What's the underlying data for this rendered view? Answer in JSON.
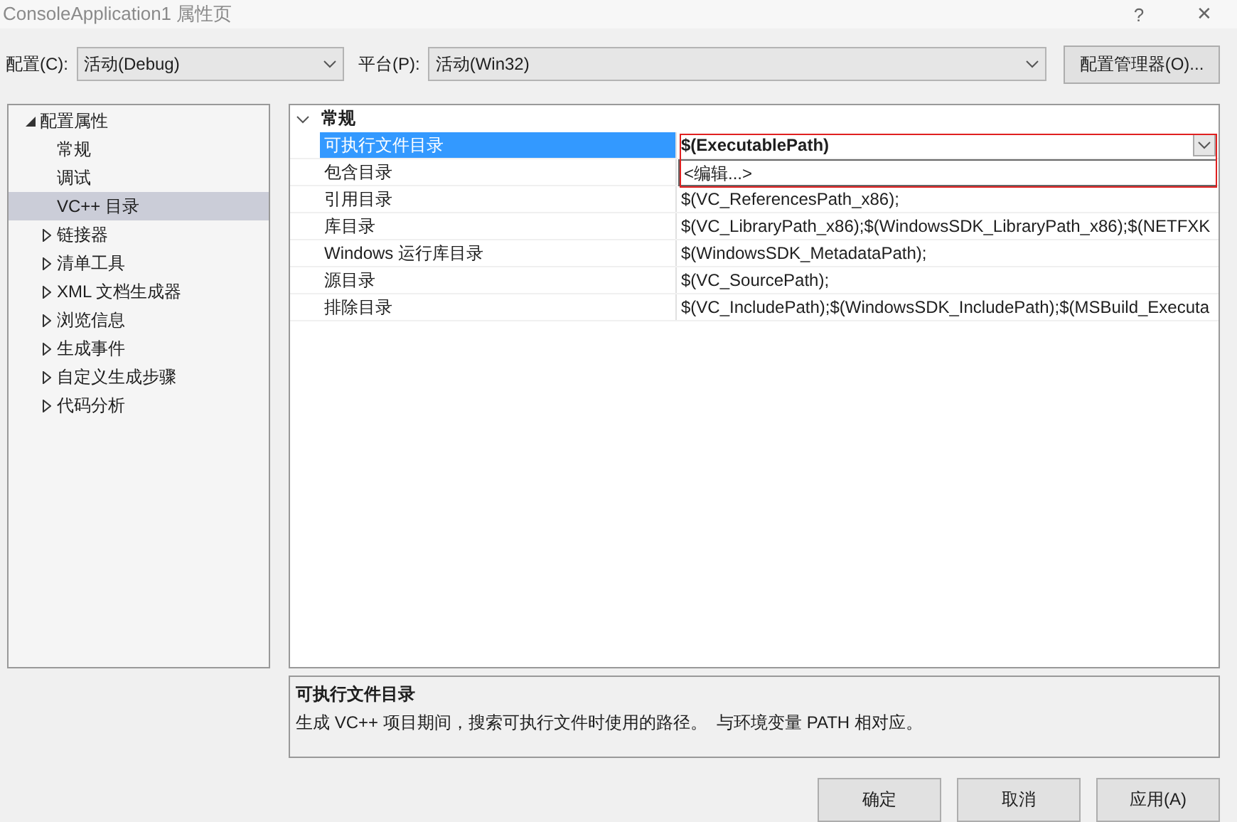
{
  "window": {
    "title": "ConsoleApplication1 属性页",
    "help": "?",
    "close": "✕"
  },
  "toolbar": {
    "config_label": "配置(C):",
    "config_value": "活动(Debug)",
    "platform_label": "平台(P):",
    "platform_value": "活动(Win32)",
    "manager_button": "配置管理器(O)..."
  },
  "tree": [
    {
      "label": "配置属性",
      "expanded": true,
      "selected": false,
      "children": [
        {
          "label": "常规",
          "selected": false,
          "expandable": false
        },
        {
          "label": "调试",
          "selected": false,
          "expandable": false
        },
        {
          "label": "VC++ 目录",
          "selected": true,
          "expandable": false
        },
        {
          "label": "链接器",
          "selected": false,
          "expandable": true
        },
        {
          "label": "清单工具",
          "selected": false,
          "expandable": true
        },
        {
          "label": "XML 文档生成器",
          "selected": false,
          "expandable": true
        },
        {
          "label": "浏览信息",
          "selected": false,
          "expandable": true
        },
        {
          "label": "生成事件",
          "selected": false,
          "expandable": true
        },
        {
          "label": "自定义生成步骤",
          "selected": false,
          "expandable": true
        },
        {
          "label": "代码分析",
          "selected": false,
          "expandable": true
        }
      ]
    }
  ],
  "property_grid": {
    "category": {
      "label": "常规",
      "expanded": true
    },
    "rows": [
      {
        "name": "可执行文件目录",
        "value": "$(ExecutablePath)",
        "selected": true
      },
      {
        "name": "包含目录",
        "value": "",
        "selected": false
      },
      {
        "name": "引用目录",
        "value": "$(VC_ReferencesPath_x86);",
        "selected": false
      },
      {
        "name": "库目录",
        "value": "$(VC_LibraryPath_x86);$(WindowsSDK_LibraryPath_x86);$(NETFXK",
        "selected": false
      },
      {
        "name": "Windows 运行库目录",
        "value": "$(WindowsSDK_MetadataPath);",
        "selected": false
      },
      {
        "name": "源目录",
        "value": "$(VC_SourcePath);",
        "selected": false
      },
      {
        "name": "排除目录",
        "value": "$(VC_IncludePath);$(WindowsSDK_IncludePath);$(MSBuild_Executa",
        "selected": false
      }
    ],
    "dropdown": {
      "open": true,
      "options": [
        "<编辑...>"
      ]
    },
    "highlight": true
  },
  "description": {
    "title": "可执行文件目录",
    "text": "生成 VC++ 项目期间，搜索可执行文件时使用的路径。  与环境变量 PATH 相对应。"
  },
  "buttons": [
    "确定",
    "取消",
    "应用(A)"
  ]
}
